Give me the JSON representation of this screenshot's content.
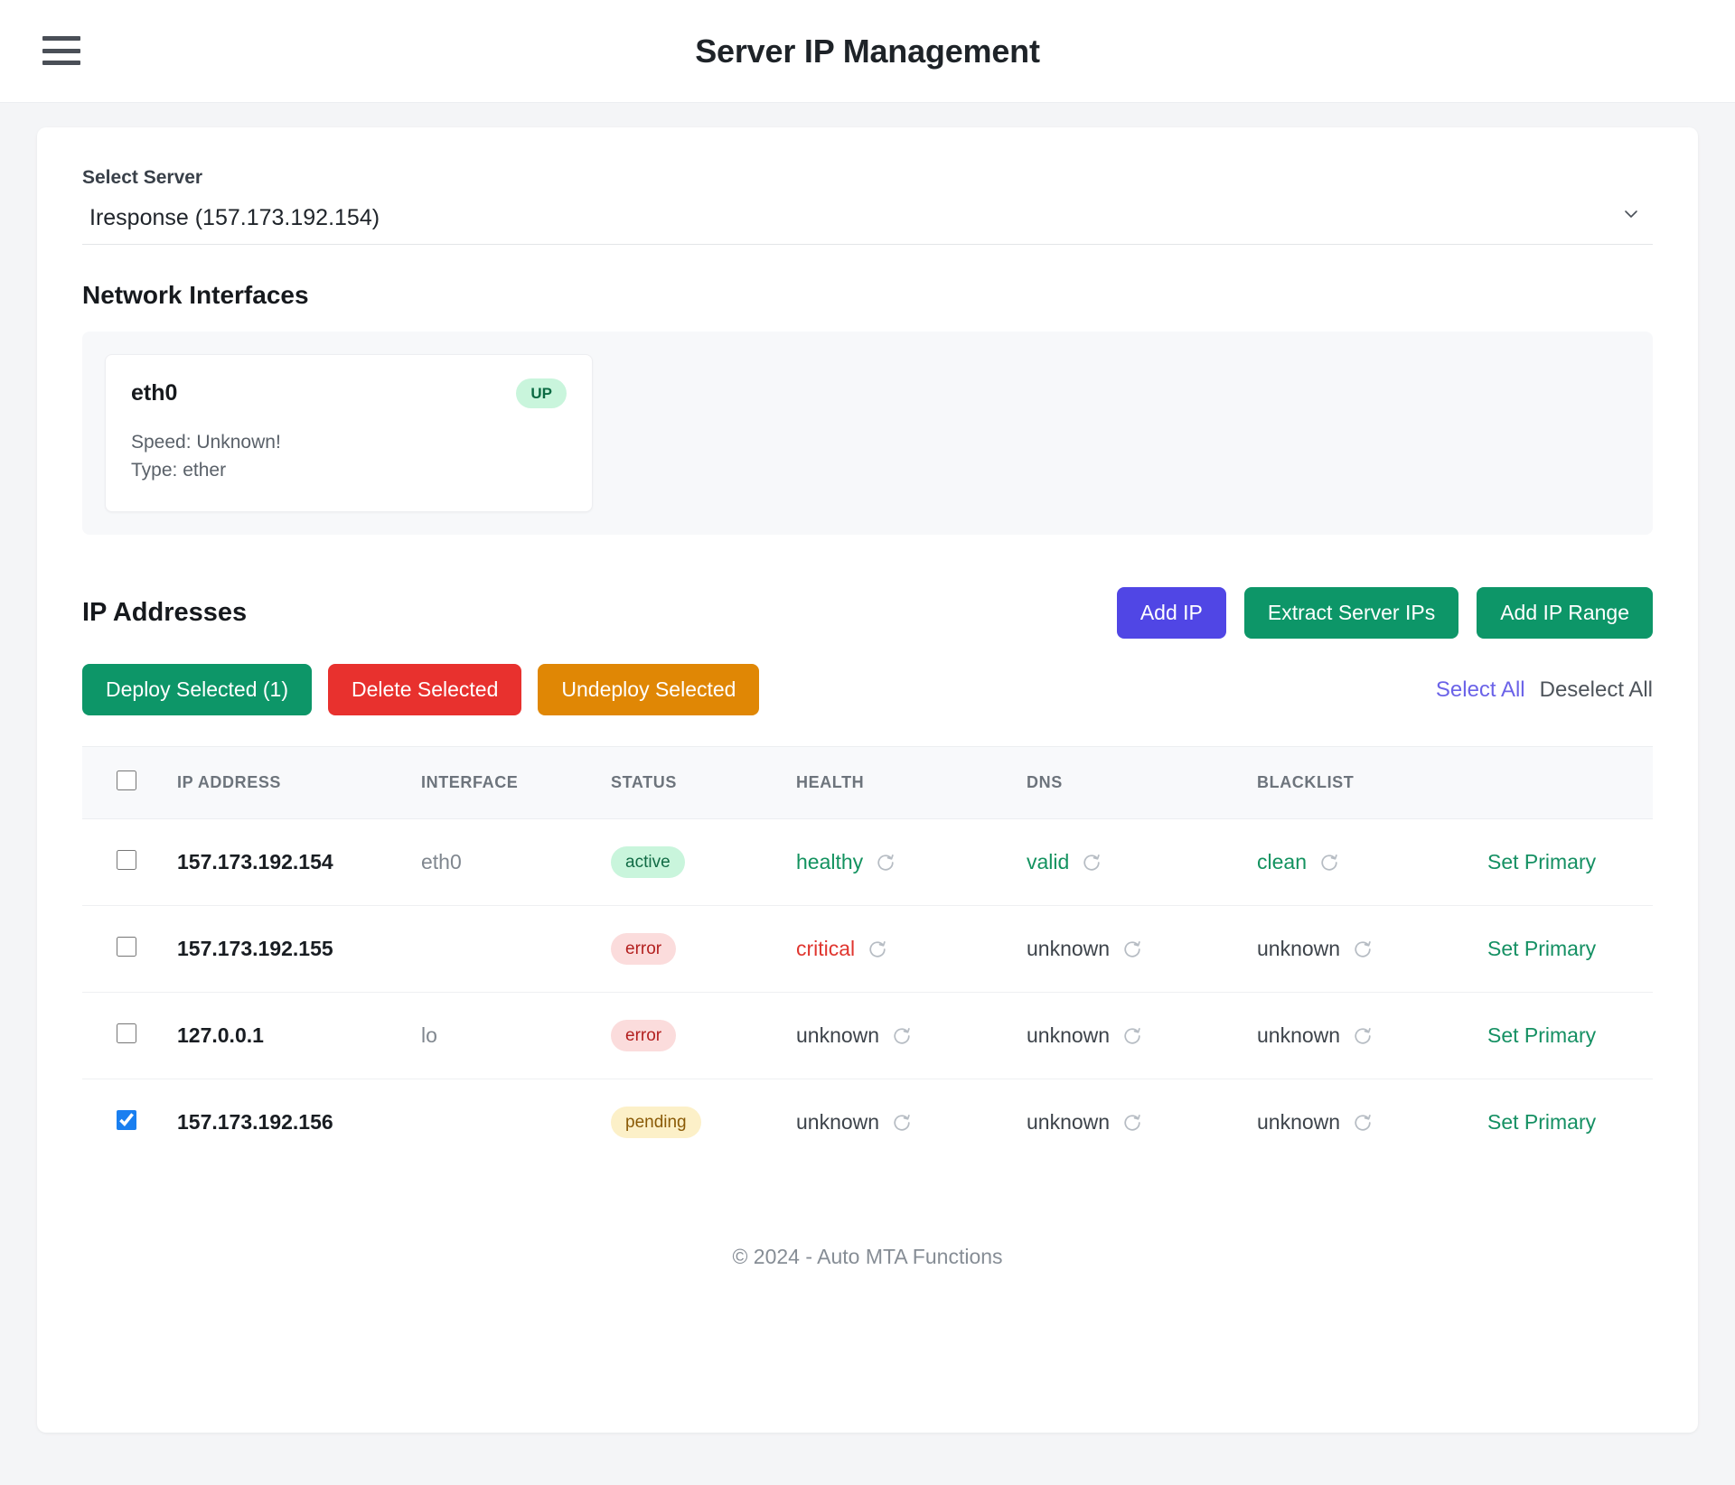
{
  "header": {
    "title": "Server IP Management",
    "menu_icon": "hamburger-menu-icon"
  },
  "server_select": {
    "label": "Select Server",
    "value": "Iresponse (157.173.192.154)",
    "chevron_icon": "chevron-down-icon"
  },
  "interfaces_section": {
    "title": "Network Interfaces",
    "cards": [
      {
        "name": "eth0",
        "status": "UP",
        "speed": "Speed: Unknown!",
        "type": "Type: ether"
      }
    ]
  },
  "ip_section": {
    "title": "IP Addresses",
    "primary_buttons": [
      {
        "label": "Add IP",
        "color": "#5046e5"
      },
      {
        "label": "Extract Server IPs",
        "color": "#0d9668"
      },
      {
        "label": "Add IP Range",
        "color": "#0d9668"
      }
    ],
    "action_buttons": [
      {
        "label": "Deploy Selected (1)",
        "color": "#0d9668"
      },
      {
        "label": "Delete Selected",
        "color": "#e8312e"
      },
      {
        "label": "Undeploy Selected",
        "color": "#e08705"
      }
    ],
    "select_all_label": "Select All",
    "deselect_all_label": "Deselect All",
    "columns": [
      "IP ADDRESS",
      "INTERFACE",
      "STATUS",
      "HEALTH",
      "DNS",
      "BLACKLIST"
    ],
    "rows": [
      {
        "checked": false,
        "ip": "157.173.192.154",
        "interface": "eth0",
        "status": "active",
        "status_kind": "active",
        "health": "healthy",
        "health_kind": "healthy",
        "dns": "valid",
        "dns_kind": "valid",
        "blacklist": "clean",
        "blacklist_kind": "clean",
        "action": "Set Primary"
      },
      {
        "checked": false,
        "ip": "157.173.192.155",
        "interface": "",
        "status": "error",
        "status_kind": "error",
        "health": "critical",
        "health_kind": "critical",
        "dns": "unknown",
        "dns_kind": "unknown",
        "blacklist": "unknown",
        "blacklist_kind": "unknown",
        "action": "Set Primary"
      },
      {
        "checked": false,
        "ip": "127.0.0.1",
        "interface": "lo",
        "status": "error",
        "status_kind": "error",
        "health": "unknown",
        "health_kind": "unknown",
        "dns": "unknown",
        "dns_kind": "unknown",
        "blacklist": "unknown",
        "blacklist_kind": "unknown",
        "action": "Set Primary"
      },
      {
        "checked": true,
        "ip": "157.173.192.156",
        "interface": "",
        "status": "pending",
        "status_kind": "pending",
        "health": "unknown",
        "health_kind": "unknown",
        "dns": "unknown",
        "dns_kind": "unknown",
        "blacklist": "unknown",
        "blacklist_kind": "unknown",
        "action": "Set Primary"
      }
    ],
    "refresh_icon": "refresh-icon"
  },
  "footer": {
    "copyright": "© 2024 - Auto MTA Functions"
  }
}
